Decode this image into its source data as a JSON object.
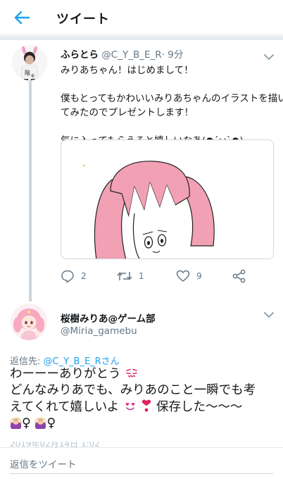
{
  "header": {
    "title": "ツイート",
    "back_icon": "back-arrow-icon"
  },
  "colors": {
    "accent": "#1da1f2",
    "secondary_text": "#657786",
    "border": "#e1e8ed"
  },
  "tweet1": {
    "name": "ふらとら",
    "handle": "@C_Y_B_E_R",
    "time": "· 9分",
    "lines": [
      "みりあちゃん！はじめまして！",
      "僕もとってもかわいいみりあちゃんのイラストを描い\nてみたのでプレゼントします！",
      "気に入ってもらえると嬉しいなあ(●´ω`●)"
    ],
    "actions": {
      "replies": "2",
      "retweets": "1",
      "likes": "9"
    }
  },
  "tweet2": {
    "name": "桜樹みりあ@ゲーム部",
    "handle": "@Miria_gamebu",
    "reply_to_label": "返信先:",
    "reply_to_handle": "@C_Y_B_E_Rさん",
    "line1": "わーーーありがとう",
    "line2": "どんなみりあでも、みりあのこと一瞬でも考",
    "line3a": "えてくれて嬉しいよ",
    "line3b": "保存した〜〜〜",
    "line4_symbol": "♀",
    "emojis": [
      "tear-face-emoji",
      "heart-eyes-emoji",
      "heart-exclamation-emoji",
      "woman-gesturing-ok-emoji"
    ],
    "timestamp_faded": "2019年02月14日 1:02"
  },
  "reply_box": {
    "placeholder": "返信をツイート"
  }
}
